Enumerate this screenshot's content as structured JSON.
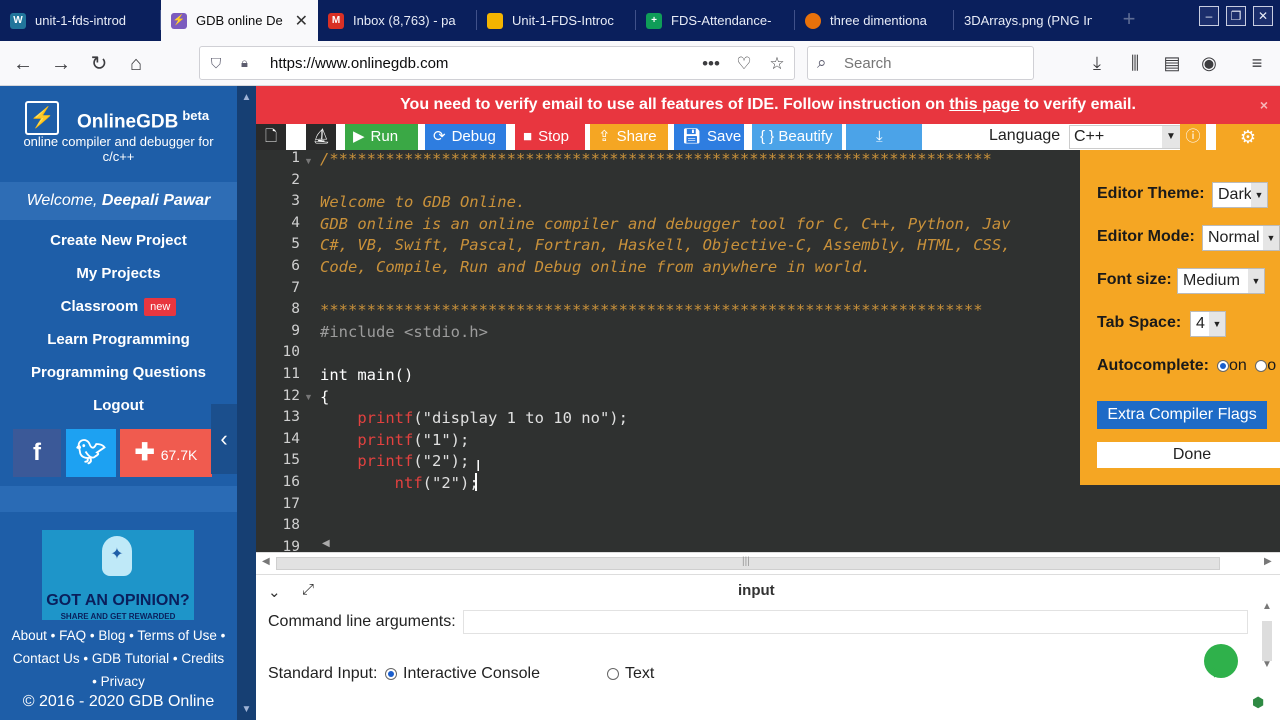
{
  "browser": {
    "tabs": [
      {
        "label": "unit-1-fds-introd",
        "icon": "wordpress-icon",
        "color": "#21759b"
      },
      {
        "label": "GDB online De",
        "icon": "onlinegdb-icon",
        "color": "#7c5cbf"
      },
      {
        "label": "Inbox (8,763) - pa",
        "icon": "gmail-icon",
        "color": "#d93025"
      },
      {
        "label": "Unit-1-FDS-Introc",
        "icon": "google-slides-icon",
        "color": "#f4b400"
      },
      {
        "label": "FDS-Attendance-",
        "icon": "google-sheets-icon",
        "color": "#0f9d58"
      },
      {
        "label": "three dimentiona",
        "icon": "tab-favicon-icon",
        "color": "#e8710a"
      },
      {
        "label": "3DArrays.png (PNG In",
        "icon": "image-icon",
        "color": ""
      }
    ],
    "url": "https://www.onlinegdb.com",
    "search_placeholder": "Search"
  },
  "sidebar": {
    "brand": "OnlineGDB",
    "brand_sup": "beta",
    "tagline": "online compiler and debugger for c/c++",
    "welcome_prefix": "Welcome,",
    "welcome_user": "Deepali Pawar",
    "links": [
      "Create New Project",
      "My Projects",
      "Classroom",
      "Learn Programming",
      "Programming Questions",
      "Logout"
    ],
    "new_badge": "new",
    "share_count": "67.7K",
    "ad_title": "GOT AN OPINION?",
    "ad_sub": "SHARE AND GET REWARDED",
    "footer_line1": "About • FAQ • Blog • Terms of Use •",
    "footer_line2": "Contact Us • GDB Tutorial • Credits",
    "footer_line3": "• Privacy",
    "copyright": "© 2016 - 2020 GDB Online"
  },
  "banner": {
    "text_before": "You need to verify email to use all features of IDE. Follow instruction on",
    "link": "this page",
    "text_after": "to verify email.",
    "close": "×"
  },
  "toolbar": {
    "run": "Run",
    "debug": "Debug",
    "stop": "Stop",
    "share": "Share",
    "save": "Save",
    "beautify": "{ } Beautify",
    "language_label": "Language",
    "language_value": "C++"
  },
  "code": {
    "lines": [
      {
        "n": "1",
        "text": "/***********************************************************************",
        "cls": "c-comment"
      },
      {
        "n": "2",
        "text": "",
        "cls": "c-comment"
      },
      {
        "n": "3",
        "text": "Welcome to GDB Online.",
        "cls": "c-comment"
      },
      {
        "n": "4",
        "text": "GDB online is an online compiler and debugger tool for C, C++, Python, Jav",
        "cls": "c-comment"
      },
      {
        "n": "5",
        "text": "C#, VB, Swift, Pascal, Fortran, Haskell, Objective-C, Assembly, HTML, CSS,",
        "cls": "c-comment"
      },
      {
        "n": "6",
        "text": "Code, Compile, Run and Debug online from anywhere in world.",
        "cls": "c-comment"
      },
      {
        "n": "7",
        "text": "",
        "cls": "c-comment"
      },
      {
        "n": "8",
        "text": "***********************************************************************",
        "cls": "c-comment"
      },
      {
        "n": "9",
        "text": "#include <stdio.h>",
        "cls": "c-prep"
      },
      {
        "n": "10",
        "text": "",
        "cls": "c-plain"
      },
      {
        "n": "11",
        "text": "int main()",
        "cls": "c-plain"
      },
      {
        "n": "12",
        "text": "{",
        "cls": "c-plain"
      },
      {
        "n": "13",
        "text": "    printf(\"display 1 to 10 no\");",
        "cls": "c-code"
      },
      {
        "n": "14",
        "text": "    printf(\"1\");",
        "cls": "c-code"
      },
      {
        "n": "15",
        "text": "    printf(\"2\");",
        "cls": "c-code"
      },
      {
        "n": "16",
        "text": "        ntf(\"2\");",
        "cls": "c-code"
      },
      {
        "n": "17",
        "text": "",
        "cls": "c-plain"
      },
      {
        "n": "18",
        "text": "",
        "cls": "c-plain"
      },
      {
        "n": "19",
        "text": "",
        "cls": "c-plain"
      }
    ]
  },
  "settings": {
    "theme_label": "Editor Theme:",
    "theme_value": "Dark",
    "mode_label": "Editor Mode:",
    "mode_value": "Normal",
    "font_label": "Font size:",
    "font_value": "Medium",
    "tab_label": "Tab Space:",
    "tab_value": "4",
    "autocomplete_label": "Autocomplete:",
    "autocomplete_on": "on",
    "autocomplete_off": "o",
    "extra_flags": "Extra Compiler Flags",
    "done": "Done"
  },
  "io": {
    "title": "input",
    "cmd_label": "Command line arguments:",
    "stdin_label": "Standard Input:",
    "opt_console": "Interactive Console",
    "opt_text": "Text"
  }
}
